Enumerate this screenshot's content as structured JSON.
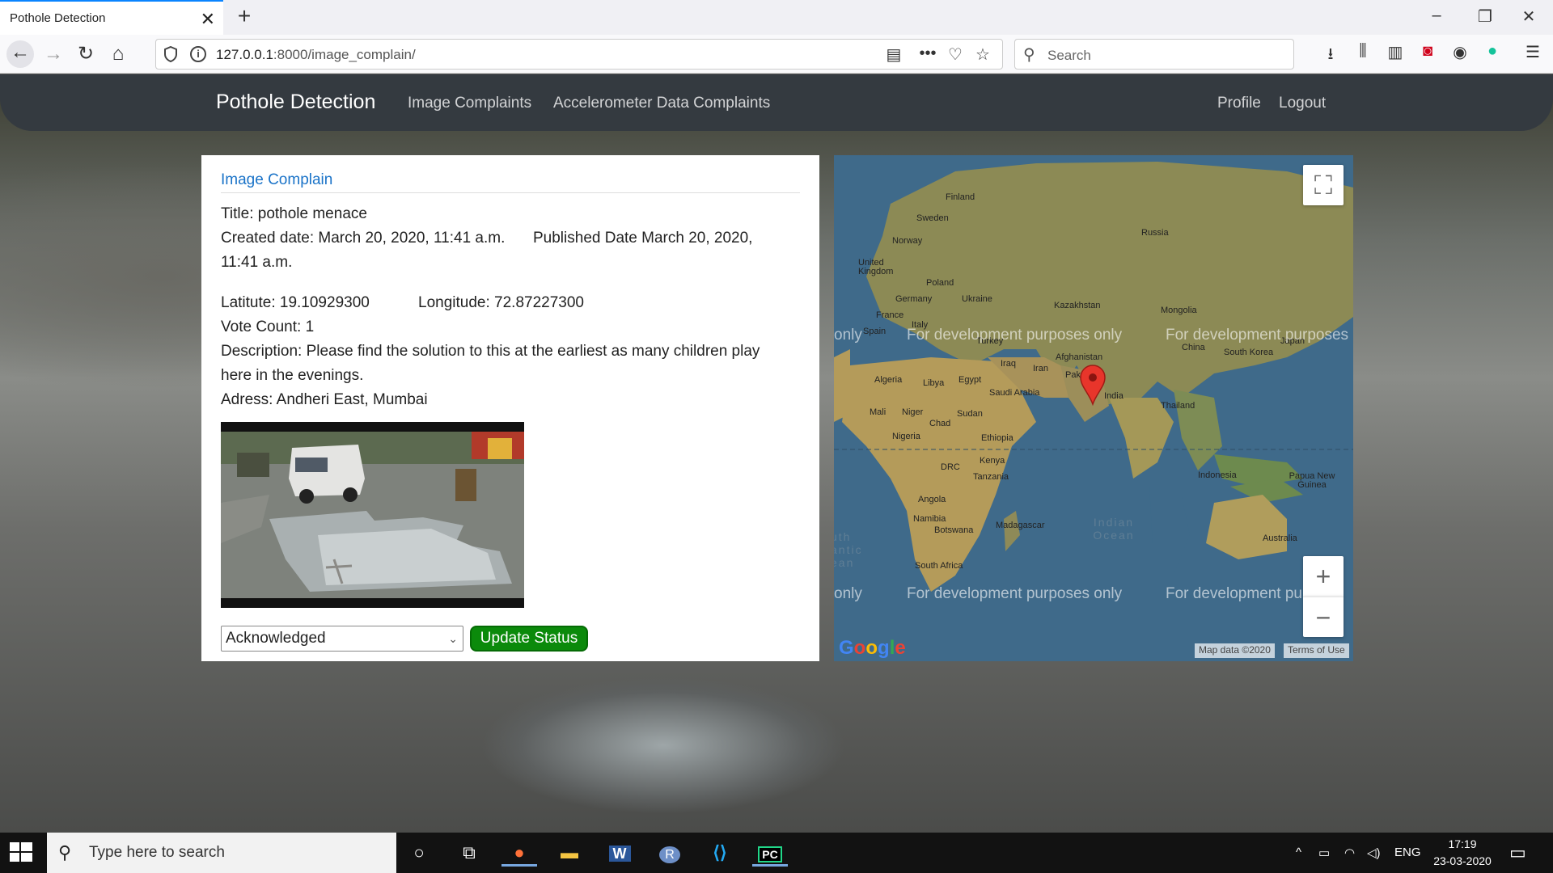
{
  "browser": {
    "tab_title": "Pothole Detection",
    "url_host": "127.0.0.1",
    "url_rest": ":8000/image_complain/",
    "search_placeholder": "Search"
  },
  "site": {
    "brand": "Pothole Detection",
    "nav_left": [
      "Image Complaints",
      "Accelerometer Data Complaints"
    ],
    "nav_right": [
      "Profile",
      "Logout"
    ]
  },
  "complaint": {
    "heading": "Image Complain",
    "title": "Title: pothole menace",
    "created_line": "Created date: March 20, 2020, 11:41 a.m.",
    "published_line": "Published Date March 20, 2020,",
    "published_time": "11:41 a.m.",
    "latitude": "Latitute: 19.10929300",
    "longitude": "Longitude: 72.87227300",
    "vote_count": "Vote Count: 1",
    "description_1": "Description: Please find the solution to this at the earliest as many children play",
    "description_2": "here in the evenings.",
    "address": "Adress: Andheri East, Mumbai",
    "status_selected": "Acknowledged",
    "update_label": "Update Status"
  },
  "map": {
    "dev_watermark": "For development purposes only",
    "dev_watermark_short": "For development purposes",
    "dev_watermark_cut": "For development pu",
    "only_fragment": "only",
    "zoom_in": "+",
    "zoom_out": "−",
    "google": "Google",
    "map_data": "Map data ©2020",
    "terms": "Terms of Use",
    "labels": [
      "Finland",
      "Sweden",
      "Norway",
      "Russia",
      "United Kingdom",
      "Poland",
      "Germany",
      "Ukraine",
      "France",
      "Kazakhstan",
      "Mongolia",
      "Spain",
      "Italy",
      "Turkey",
      "Iraq",
      "Iran",
      "Afghanistan",
      "China",
      "South Korea",
      "Japan",
      "Algeria",
      "Libya",
      "Egypt",
      "Saudi Arabia",
      "Pak",
      "India",
      "Thailand",
      "Mali",
      "Niger",
      "Chad",
      "Sudan",
      "Nigeria",
      "Ethiopia",
      "DRC",
      "Kenya",
      "Tanzania",
      "Angola",
      "Namibia",
      "Botswana",
      "Madagascar",
      "South Africa",
      "Indonesia",
      "Papua New Guinea",
      "Australia",
      "Indian Ocean",
      "uth antic ean"
    ]
  },
  "taskbar": {
    "search_placeholder": "Type here to search",
    "lang": "ENG",
    "time": "17:19",
    "date": "23-03-2020"
  }
}
